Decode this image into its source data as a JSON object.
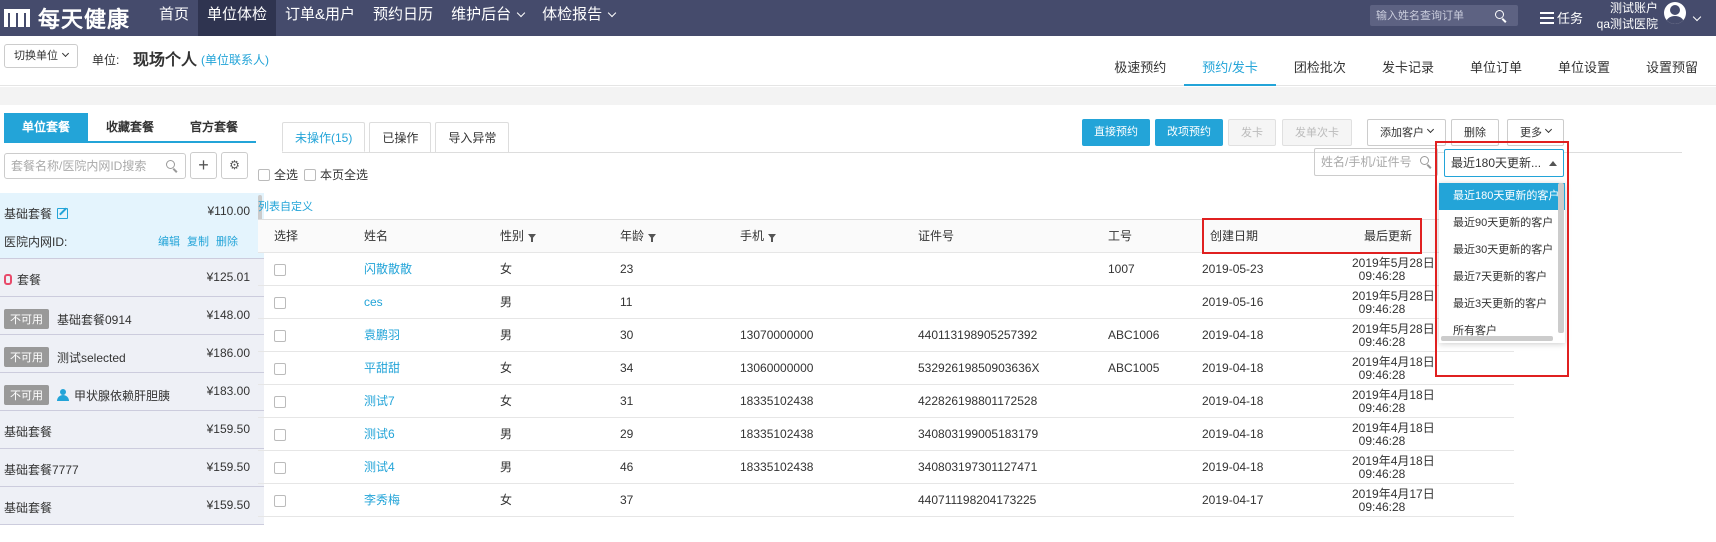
{
  "topbar": {
    "logo_text": "每天健康",
    "nav": [
      {
        "label": "首页",
        "active": false,
        "dropdown": false
      },
      {
        "label": "单位体检",
        "active": true,
        "dropdown": false
      },
      {
        "label": "订单&用户",
        "active": false,
        "dropdown": false
      },
      {
        "label": "预约日历",
        "active": false,
        "dropdown": false
      },
      {
        "label": "维护后台",
        "active": false,
        "dropdown": true
      },
      {
        "label": "体检报告",
        "active": false,
        "dropdown": true
      }
    ],
    "search_placeholder": "输入姓名查询订单",
    "task_label": "任务",
    "account_line1": "测试账户",
    "account_line2": "qa测试医院"
  },
  "subhead": {
    "switch_unit_label": "切换单位",
    "unit_label": "单位:",
    "unit_name": "现场个人",
    "unit_contact": "(单位联系人)",
    "tabs": [
      "极速预约",
      "预约/发卡",
      "团检批次",
      "发卡记录",
      "单位订单",
      "单位设置",
      "设置预留"
    ],
    "active_tab": 1
  },
  "sidebar": {
    "tabs": [
      "单位套餐",
      "收藏套餐",
      "官方套餐"
    ],
    "search_placeholder": "套餐名称/医院内网ID搜索",
    "add_label": "+",
    "first_package": {
      "name": "基础套餐",
      "price": "¥110.00",
      "id_label": "医院内网ID:",
      "links": [
        "编辑",
        "复制",
        "删除"
      ]
    },
    "packages": [
      {
        "badge": "",
        "icon": "pin-icon",
        "name": "套餐",
        "price": "¥125.01"
      },
      {
        "badge": "不可用",
        "icon": "",
        "name": "基础套餐0914",
        "price": "¥148.00"
      },
      {
        "badge": "不可用",
        "icon": "",
        "name": "测试selected",
        "price": "¥186.00"
      },
      {
        "badge": "不可用",
        "icon": "person-icon",
        "name": "甲状腺依赖肝胆胰",
        "price": "¥183.00"
      },
      {
        "badge": "",
        "icon": "",
        "name": "基础套餐",
        "price": "¥159.50"
      },
      {
        "badge": "",
        "icon": "",
        "name": "基础套餐7777",
        "price": "¥159.50"
      },
      {
        "badge": "",
        "icon": "",
        "name": "基础套餐",
        "price": "¥159.50"
      }
    ]
  },
  "main": {
    "tabs": [
      "未操作(15)",
      "已操作",
      "导入异常"
    ],
    "buttons": {
      "direct_book": "直接预约",
      "change_book": "改项预约",
      "issue_card": "发卡",
      "issue_times_card": "发单次卡",
      "add_customer": "添加客户",
      "delete": "删除",
      "more": "更多"
    },
    "select_all": "全选",
    "select_page": "本页全选",
    "list_custom": "列表自定义",
    "filter_placeholder": "姓名/手机/证件号",
    "columns": [
      "选择",
      "姓名",
      "性别",
      "年龄",
      "手机",
      "证件号",
      "工号",
      "创建日期",
      "最后更新"
    ],
    "rows": [
      {
        "name": "闪散散散",
        "gender": "女",
        "age": "23",
        "phone": "",
        "id_no": "",
        "emp_no": "1007",
        "created": "2019-05-23",
        "updated_date": "2019年5月28日",
        "updated_time": "09:46:28"
      },
      {
        "name": "ces",
        "gender": "男",
        "age": "11",
        "phone": "",
        "id_no": "",
        "emp_no": "",
        "created": "2019-05-16",
        "updated_date": "2019年5月28日",
        "updated_time": "09:46:28"
      },
      {
        "name": "袁鹏羽",
        "gender": "男",
        "age": "30",
        "phone": "13070000000",
        "id_no": "440113198905257392",
        "emp_no": "ABC1006",
        "created": "2019-04-18",
        "updated_date": "2019年5月28日",
        "updated_time": "09:46:28"
      },
      {
        "name": "平甜甜",
        "gender": "女",
        "age": "34",
        "phone": "13060000000",
        "id_no": "53292619850903636X",
        "emp_no": "ABC1005",
        "created": "2019-04-18",
        "updated_date": "2019年4月18日",
        "updated_time": "09:46:28"
      },
      {
        "name": "测试7",
        "gender": "女",
        "age": "31",
        "phone": "18335102438",
        "id_no": "422826198801172528",
        "emp_no": "",
        "created": "2019-04-18",
        "updated_date": "2019年4月18日",
        "updated_time": "09:46:28"
      },
      {
        "name": "测试6",
        "gender": "男",
        "age": "29",
        "phone": "18335102438",
        "id_no": "340803199005183179",
        "emp_no": "",
        "created": "2019-04-18",
        "updated_date": "2019年4月18日",
        "updated_time": "09:46:28"
      },
      {
        "name": "测试4",
        "gender": "男",
        "age": "46",
        "phone": "18335102438",
        "id_no": "340803197301127471",
        "emp_no": "",
        "created": "2019-04-18",
        "updated_date": "2019年4月18日",
        "updated_time": "09:46:28"
      },
      {
        "name": "李秀梅",
        "gender": "女",
        "age": "37",
        "phone": "",
        "id_no": "440711198204173225",
        "emp_no": "",
        "created": "2019-04-17",
        "updated_date": "2019年4月17日",
        "updated_time": "09:46:28"
      }
    ],
    "range_select": {
      "value": "最近180天更新...",
      "options": [
        "最近180天更新的客户",
        "最近90天更新的客户",
        "最近30天更新的客户",
        "最近7天更新的客户",
        "最近3天更新的客户",
        "所有客户"
      ]
    }
  },
  "colors": {
    "topbar": "#454b6c",
    "accent": "#23a4d8",
    "highlight": "#e02020"
  }
}
